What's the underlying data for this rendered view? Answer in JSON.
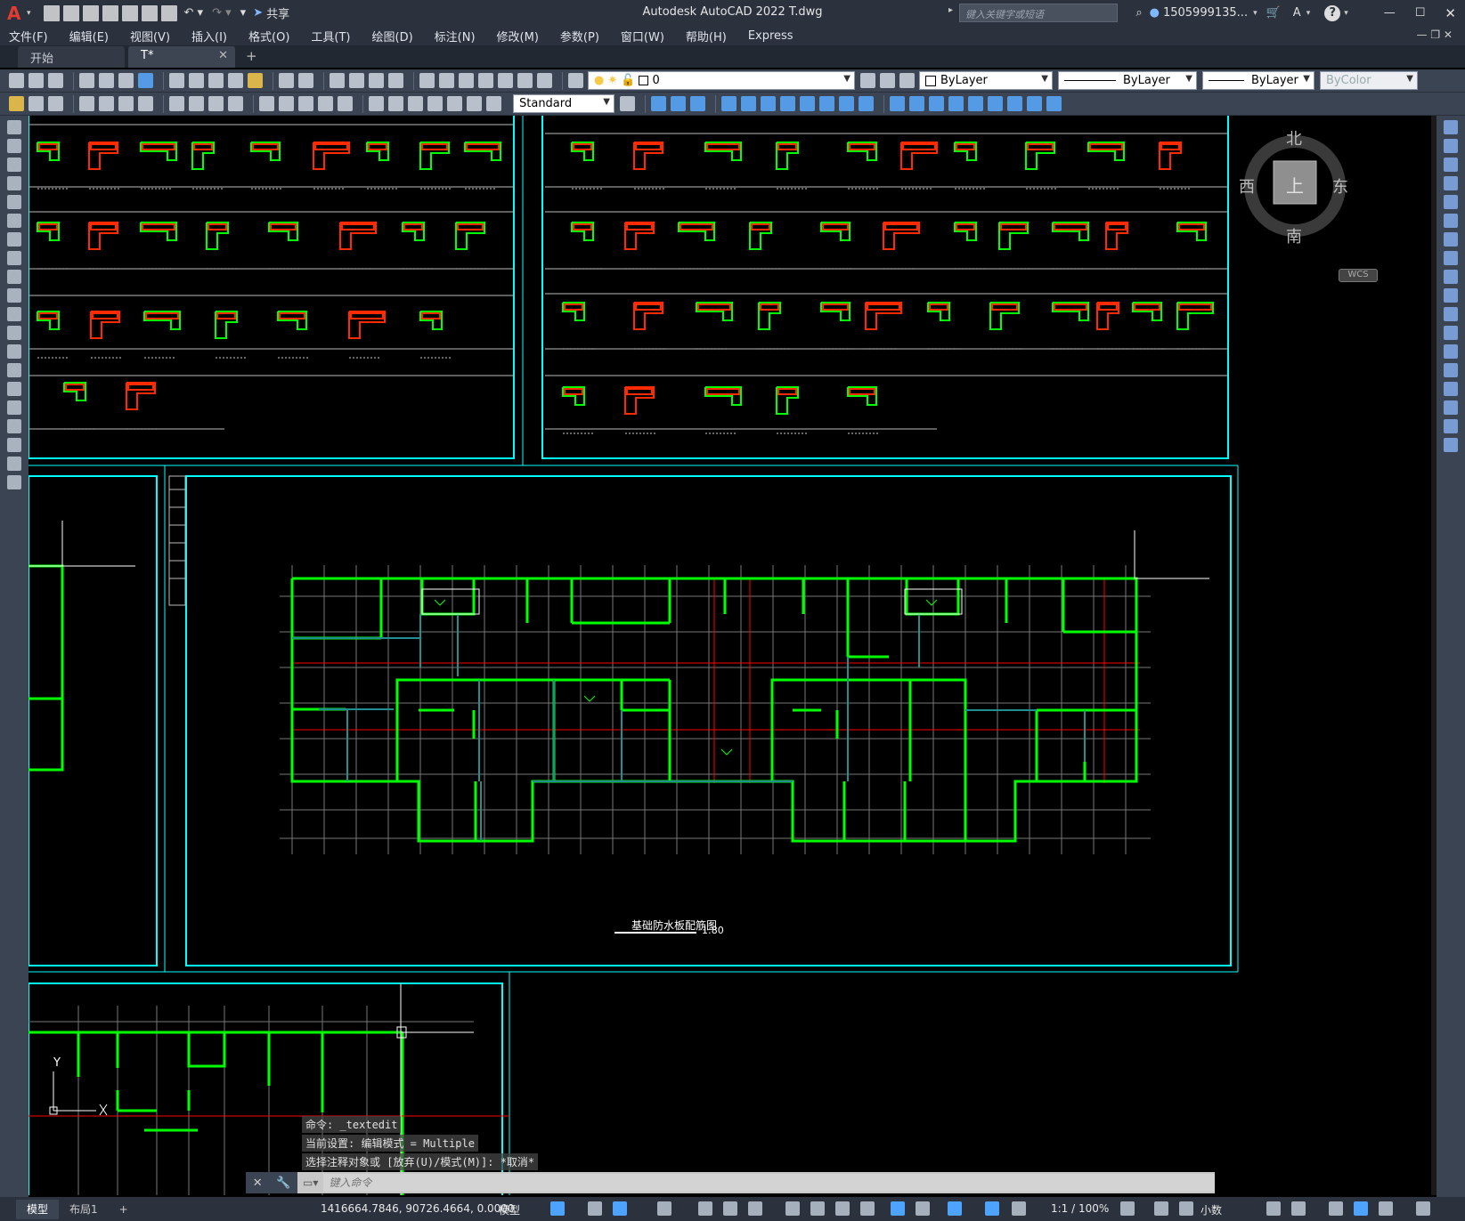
{
  "app": {
    "logo": "A",
    "share_label": "共享",
    "title": "Autodesk AutoCAD 2022    T.dwg",
    "search_placeholder": "键入关键字或短语",
    "user": "1505999135...",
    "help": "?"
  },
  "menu": [
    "文件(F)",
    "编辑(E)",
    "视图(V)",
    "插入(I)",
    "格式(O)",
    "工具(T)",
    "绘图(D)",
    "标注(N)",
    "修改(M)",
    "参数(P)",
    "窗口(W)",
    "帮助(H)",
    "Express"
  ],
  "tabs": {
    "start": "开始",
    "active": "T*",
    "close": "✕",
    "add": "+"
  },
  "toolbar1": {
    "layer_value": "0",
    "color_value": "ByLayer",
    "linetype_value": "ByLayer",
    "lineweight_value": "ByLayer",
    "plotstyle_value": "ByColor"
  },
  "toolbar2": {
    "textstyle_value": "Standard"
  },
  "viewcube": {
    "north": "北",
    "south": "南",
    "west": "西",
    "east": "东",
    "top": "上",
    "wcs": "WCS"
  },
  "drawing": {
    "plan_title": "基础防水板配筋图",
    "plan_scale": "1:80",
    "axis_y": "Y",
    "colors": {
      "frame": "#00ffff",
      "wall": "#00ff00",
      "rebar": "#ff2a00",
      "grid": "#808080",
      "axisline": "#ff0000"
    }
  },
  "command": {
    "history": [
      "命令: _textedit",
      "当前设置: 编辑模式 = Multiple",
      "选择注释对象或 [放弃(U)/模式(M)]: *取消*"
    ],
    "placeholder": "键入命令"
  },
  "status": {
    "tabs": [
      "模型",
      "布局1"
    ],
    "add": "+",
    "coords": "1416664.7846, 90726.4664, 0.0000",
    "space": "模型",
    "annoscale": "1:1 / 100%",
    "units": "小数"
  }
}
